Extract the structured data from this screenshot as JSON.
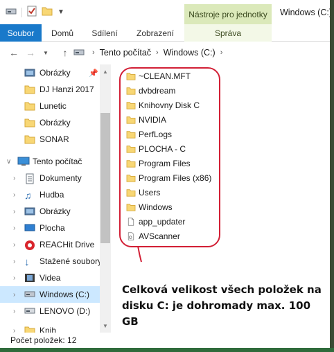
{
  "window": {
    "title": "Windows (C:)",
    "contextual_group": "Nástroje pro jednotky"
  },
  "ribbon": {
    "tabs": [
      {
        "label": "Soubor"
      },
      {
        "label": "Domů"
      },
      {
        "label": "Sdílení"
      },
      {
        "label": "Zobrazení"
      },
      {
        "label": "Správa"
      }
    ]
  },
  "address": {
    "crumbs": [
      "Tento počítač",
      "Windows (C:)"
    ]
  },
  "nav": {
    "items": [
      {
        "label": "Obrázky",
        "icon": "pictures-icon"
      },
      {
        "label": "DJ Hanzi 2017",
        "icon": "folder-icon"
      },
      {
        "label": "Lunetic",
        "icon": "folder-icon"
      },
      {
        "label": "Obrázky",
        "icon": "folder-icon"
      },
      {
        "label": "SONAR",
        "icon": "folder-icon"
      },
      {
        "label": "Tento počítač",
        "icon": "computer-icon"
      },
      {
        "label": "Dokumenty",
        "icon": "documents-icon"
      },
      {
        "label": "Hudba",
        "icon": "music-icon"
      },
      {
        "label": "Obrázky",
        "icon": "pictures-icon"
      },
      {
        "label": "Plocha",
        "icon": "desktop-icon"
      },
      {
        "label": "REACHit Drive",
        "icon": "reachit-icon"
      },
      {
        "label": "Stažené soubory",
        "icon": "download-icon"
      },
      {
        "label": "Videa",
        "icon": "video-icon"
      },
      {
        "label": "Windows (C:)",
        "icon": "drive-icon"
      },
      {
        "label": "LENOVO (D:)",
        "icon": "drive-icon"
      },
      {
        "label": "Knih",
        "icon": "library-icon"
      }
    ]
  },
  "files": [
    {
      "name": "~CLEAN.MFT",
      "icon": "folder-icon"
    },
    {
      "name": "dvbdream",
      "icon": "folder-icon"
    },
    {
      "name": "Knihovny Disk C",
      "icon": "folder-icon"
    },
    {
      "name": "NVIDIA",
      "icon": "folder-icon"
    },
    {
      "name": "PerfLogs",
      "icon": "folder-icon"
    },
    {
      "name": "PLOCHA - C",
      "icon": "folder-icon"
    },
    {
      "name": "Program Files",
      "icon": "folder-icon"
    },
    {
      "name": "Program Files (x86)",
      "icon": "folder-icon"
    },
    {
      "name": "Users",
      "icon": "folder-icon"
    },
    {
      "name": "Windows",
      "icon": "folder-icon"
    },
    {
      "name": "app_updater",
      "icon": "file-icon"
    },
    {
      "name": "AVScanner",
      "icon": "config-file-icon"
    }
  ],
  "annotation": {
    "text": "Celková velikost všech položek na disku C: je dohromady max. 100 GB",
    "color": "#d21f35"
  },
  "status": {
    "item_count": "Počet položek: 12"
  },
  "colors": {
    "accent": "#1979ca",
    "contextual": "#dbe9ba",
    "selection": "#cce8ff",
    "folder": "#f8d775"
  }
}
